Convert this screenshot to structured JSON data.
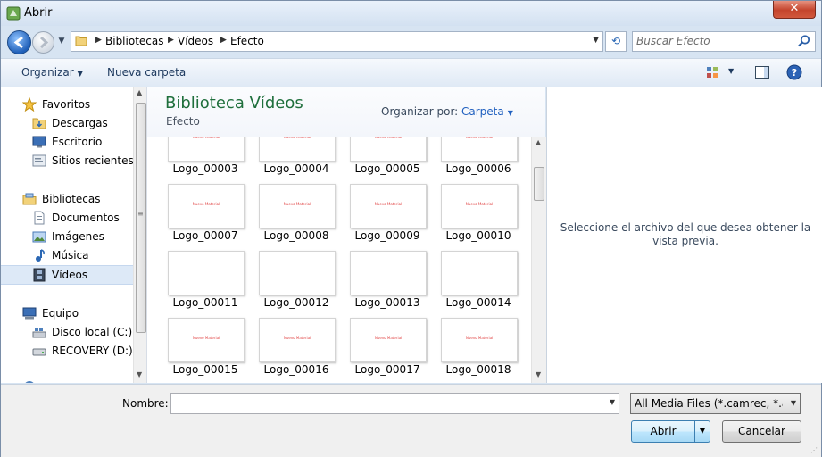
{
  "window": {
    "title": "Abrir",
    "close_label": "✕"
  },
  "address": {
    "segments": [
      "Bibliotecas",
      "Vídeos",
      "Efecto"
    ]
  },
  "search": {
    "placeholder": "Buscar Efecto"
  },
  "toolbar": {
    "organize": "Organizar",
    "new_folder": "Nueva carpeta"
  },
  "nav": {
    "favorites": {
      "label": "Favoritos",
      "items": [
        {
          "label": "Descargas",
          "icon": "downloads-folder-icon"
        },
        {
          "label": "Escritorio",
          "icon": "desktop-icon"
        },
        {
          "label": "Sitios recientes",
          "icon": "recent-places-icon"
        }
      ]
    },
    "libraries": {
      "label": "Bibliotecas",
      "items": [
        {
          "label": "Documentos",
          "icon": "documents-icon"
        },
        {
          "label": "Imágenes",
          "icon": "pictures-icon"
        },
        {
          "label": "Música",
          "icon": "music-icon"
        },
        {
          "label": "Vídeos",
          "icon": "videos-icon",
          "selected": true
        }
      ]
    },
    "computer": {
      "label": "Equipo",
      "items": [
        {
          "label": "Disco local (C:)",
          "icon": "local-disk-icon"
        },
        {
          "label": "RECOVERY (D:)",
          "icon": "drive-icon"
        }
      ]
    }
  },
  "library": {
    "title": "Biblioteca Vídeos",
    "subtitle": "Efecto",
    "arrange_label": "Organizar por:",
    "arrange_value": "Carpeta"
  },
  "files": [
    {
      "name": "Logo_00003"
    },
    {
      "name": "Logo_00004"
    },
    {
      "name": "Logo_00005"
    },
    {
      "name": "Logo_00006"
    },
    {
      "name": "Logo_00007"
    },
    {
      "name": "Logo_00008"
    },
    {
      "name": "Logo_00009"
    },
    {
      "name": "Logo_00010"
    },
    {
      "name": "Logo_00011"
    },
    {
      "name": "Logo_00012"
    },
    {
      "name": "Logo_00013"
    },
    {
      "name": "Logo_00014"
    },
    {
      "name": "Logo_00015"
    },
    {
      "name": "Logo_00016"
    },
    {
      "name": "Logo_00017"
    },
    {
      "name": "Logo_00018"
    }
  ],
  "preview": {
    "message": "Seleccione el archivo del que desea obtener la vista previa."
  },
  "footer": {
    "filename_label": "Nombre:",
    "filename_value": "",
    "filter_value": "All Media Files (*.camrec, *.avi,'",
    "open_label": "Abrir",
    "cancel_label": "Cancelar"
  },
  "colors": {
    "library_title": "#1f6f3c",
    "link": "#1f5fbf",
    "selection": "#dde9f7"
  }
}
